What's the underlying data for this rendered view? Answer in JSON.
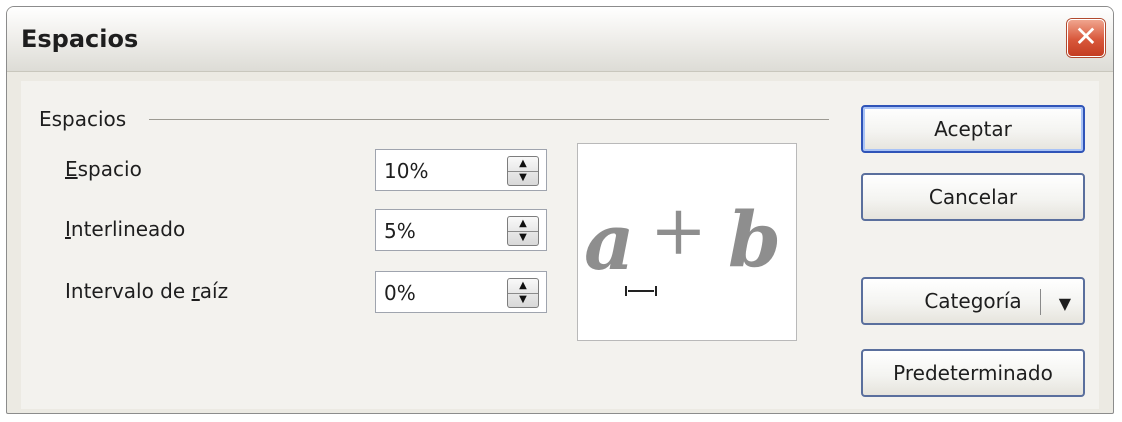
{
  "window": {
    "title": "Espacios",
    "close_symbol": "✕"
  },
  "group": {
    "label": "Espacios"
  },
  "rows": [
    {
      "label": "Espacio",
      "value": "10%"
    },
    {
      "label": "Interlineado",
      "value": "5%"
    },
    {
      "label": "Intervalo de raíz",
      "value": "0%"
    }
  ],
  "preview": {
    "expression": "a + b"
  },
  "buttons": {
    "accept": "Aceptar",
    "cancel": "Cancelar",
    "category": "Categoría",
    "default": "Predeterminado"
  },
  "icons": {
    "close": "close-icon",
    "spin": "spin-arrows-icon",
    "dropdown": "dropdown-arrow-icon"
  }
}
